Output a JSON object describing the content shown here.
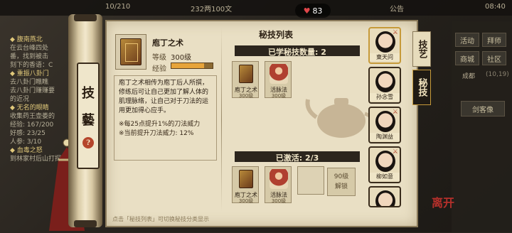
{
  "top_bar": {
    "stamina": "10/210",
    "currency": "232两100文",
    "notice_label": "公告",
    "clock": "08:40"
  },
  "likes": {
    "count": "83"
  },
  "left_quests": [
    {
      "title": "腹南燕北",
      "lines": [
        "在云台峰四处",
        "番，找到被击",
        "刻下的香语：C"
      ]
    },
    {
      "title": "重振八卦门",
      "lines": [
        "去八卦门瞧瞧",
        "去八卦门赚赚要",
        "的近况"
      ]
    },
    {
      "title": "无名的眼睛",
      "lines": [
        "收集药王壶娄的",
        "经验: 167/200",
        "好感: 23/25",
        "人参: 3/10"
      ]
    },
    {
      "title": "血毒之怒",
      "lines": [
        "到林家村后山打探"
      ]
    }
  ],
  "right_side": {
    "buttons": [
      "活动",
      "拜师",
      "商城",
      "社区"
    ],
    "zone": "成都",
    "coords": "(10,19)",
    "sword_book": "剑客像"
  },
  "scroll_tag": {
    "chars": [
      "技",
      "藝"
    ],
    "help": "?"
  },
  "skill": {
    "name": "庖丁之术",
    "level_label": "等级",
    "level_value": "300级",
    "exp_label": "经验",
    "exp_fraction": 0.8,
    "description": "庖丁之术相传为庖丁后人所撰，修练后可让自己更加了解人体的肌理脉络，让自己对于刀法的运用更加得心应手。",
    "notes": "※每25点提升1%的刀法威力\n※当前提升刀法威力: 12%"
  },
  "footer_hint": "点击「秘技列表」可切换秘技分类显示",
  "list": {
    "title": "秘技列表",
    "learned_label": "已学秘技数量: 2",
    "learned": [
      {
        "name": "庖丁之术",
        "level": "300级",
        "icon": "book-icon"
      },
      {
        "name": "活脉法",
        "level": "300级",
        "icon": "figure-icon"
      }
    ],
    "active_label": "已激活: 2/3",
    "active": [
      {
        "name": "庖丁之术",
        "level": "300级",
        "icon": "book-icon"
      },
      {
        "name": "活脉法",
        "level": "300级",
        "icon": "figure-icon"
      }
    ],
    "locked_slot": {
      "level": "90级",
      "action": "解锁"
    }
  },
  "characters": [
    {
      "name": "東天问",
      "active": true
    },
    {
      "name": "孙念雪",
      "active": false
    },
    {
      "name": "陶渊益",
      "active": false
    },
    {
      "name": "柳如意",
      "active": false
    },
    {
      "name": "",
      "active": false
    }
  ],
  "side_tabs": [
    {
      "label": "技艺",
      "active": false
    },
    {
      "label": "秘技",
      "active": true
    }
  ],
  "stamp": "离开",
  "colors": {
    "accent": "#c69a3a",
    "panel": "#e9dfc4",
    "dark": "#2c251d",
    "seal_red": "#b5302b"
  }
}
